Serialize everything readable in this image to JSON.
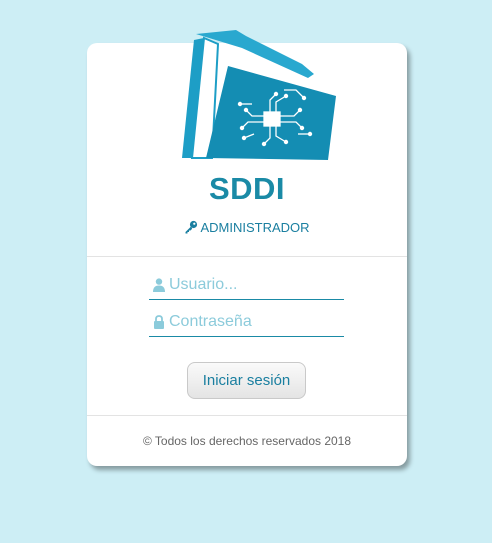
{
  "app": {
    "title": "SDDI",
    "role": "ADMINISTRADOR"
  },
  "form": {
    "username_placeholder": "Usuario...",
    "username_value": "",
    "password_placeholder": "Contraseña",
    "password_value": "",
    "submit_label": "Iniciar sesión"
  },
  "footer": {
    "text": "© Todos los derechos reservados 2018"
  },
  "icons": {
    "logo": "folder-circuit-icon",
    "role": "key-icon",
    "username": "user-icon",
    "password": "lock-icon"
  },
  "colors": {
    "background": "#cdeef5",
    "accent": "#1a8aa6",
    "placeholder": "#8ccbdb"
  }
}
